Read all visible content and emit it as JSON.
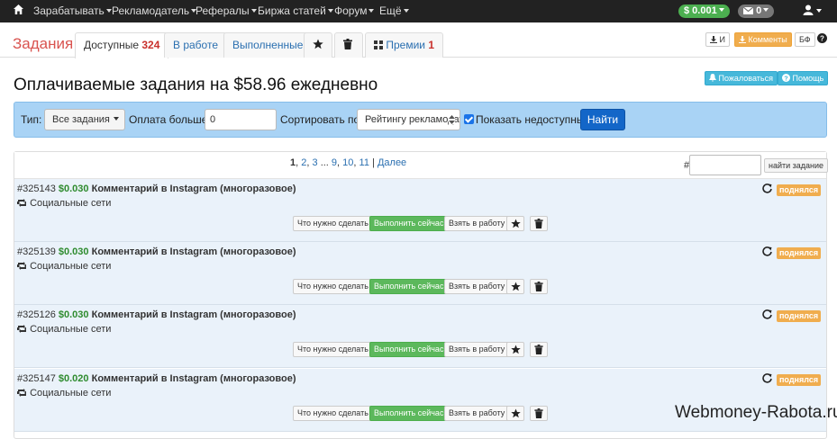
{
  "nav": {
    "items": [
      "Зарабатывать",
      "Рекламодатель",
      "Рефералы",
      "Биржа статей",
      "Форум",
      "Ещё"
    ],
    "balance": "$ 0.001",
    "messages": "0"
  },
  "tabs": {
    "heading": "Задания",
    "available_label": "Доступные",
    "available_count": "324",
    "in_work": "В работе",
    "done": "Выполненные",
    "bonuses_label": "Премии",
    "bonuses_count": "1"
  },
  "top_right": {
    "btn_i": "И",
    "btn_comments": "Комменты",
    "btn_bf": "БФ",
    "complain": "Пожаловаться",
    "help": "Помощь"
  },
  "page_title": "Оплачиваемые задания на $58.96 ежедневно",
  "filter": {
    "type_label": "Тип:",
    "type_value": "Все задания",
    "pay_label": "Оплата больше:",
    "pay_value": "0",
    "sort_label": "Сортировать по:",
    "sort_value": "Рейтингу рекламодателя",
    "show_unavailable_label": "Показать недоступные",
    "show_unavailable_checked": true,
    "find_label": "Найти"
  },
  "pager": {
    "current": "1",
    "p2": "2",
    "p3": "3",
    "ellipsis": "...",
    "p9": "9",
    "p10": "10",
    "p11": "11",
    "sep": "|",
    "next": "Далее",
    "hash": "#",
    "find_task": "найти задание"
  },
  "task_buttons": {
    "what_to_do": "Что нужно сделать",
    "do_now": "Выполнить сейчас",
    "take": "Взять в работу"
  },
  "tasks": [
    {
      "id": "#325143",
      "price": "$0.030",
      "title": "Комментарий в Instagram (многоразовое)",
      "category": "Социальные сети",
      "badge": "поднялся"
    },
    {
      "id": "#325139",
      "price": "$0.030",
      "title": "Комментарий в Instagram (многоразовое)",
      "category": "Социальные сети",
      "badge": "поднялся"
    },
    {
      "id": "#325126",
      "price": "$0.030",
      "title": "Комментарий в Instagram (многоразовое)",
      "category": "Социальные сети",
      "badge": "поднялся"
    },
    {
      "id": "#325147",
      "price": "$0.020",
      "title": "Комментарий в Instagram (многоразовое)",
      "category": "Социальные сети",
      "badge": "поднялся"
    }
  ],
  "watermark": "Webmoney-Rabota.ru",
  "colors": {
    "navbar": "#222222",
    "green": "#5cb85c",
    "orange": "#f0ad4e",
    "filter_bg": "#a9d3f5",
    "primary": "#1366c8"
  }
}
